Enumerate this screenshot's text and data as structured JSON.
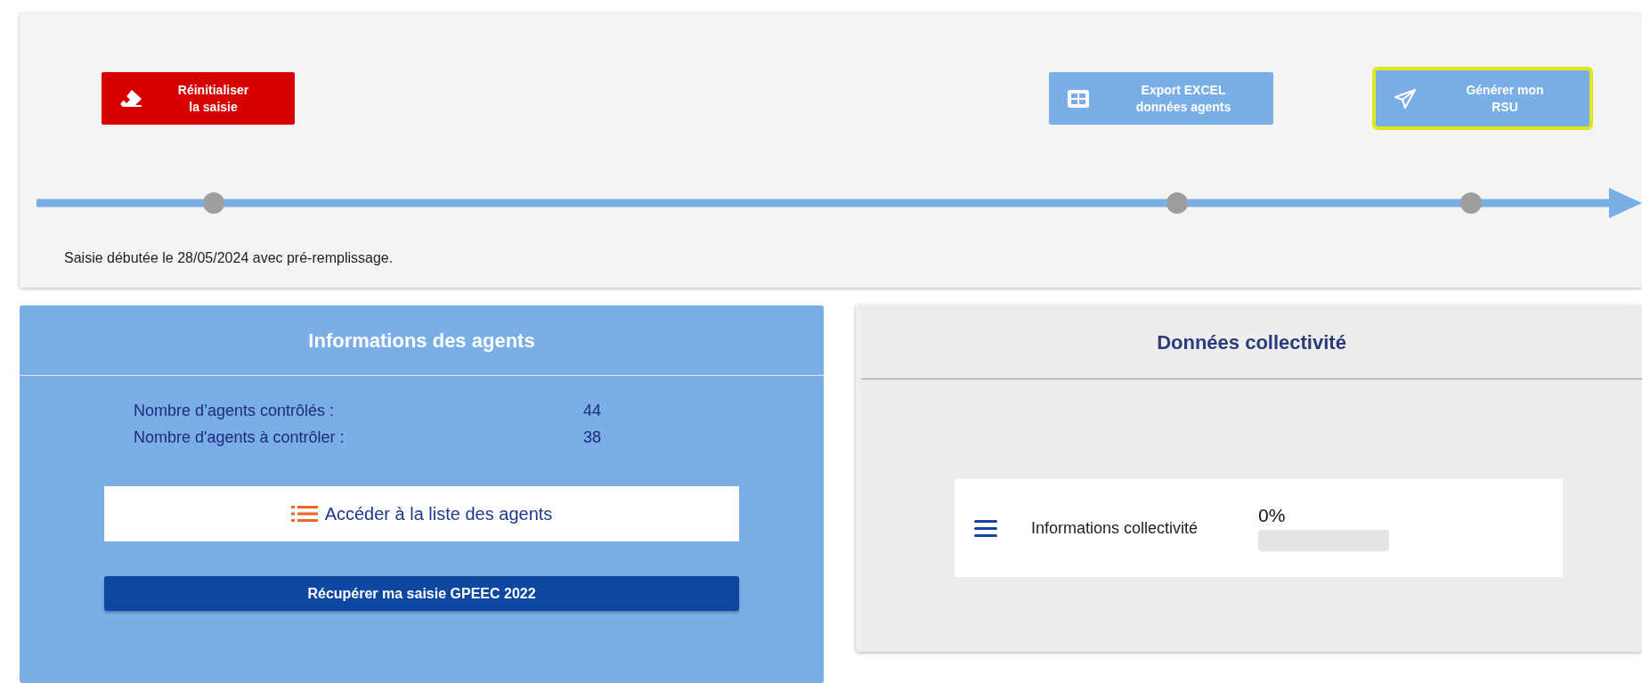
{
  "toolbar": {
    "buttons": [
      {
        "kind": "reset",
        "label": "Réinitialiser la saisie",
        "highlighted": false
      },
      {
        "kind": "export",
        "label": "Export EXCEL données agents",
        "highlighted": false
      },
      {
        "kind": "generate",
        "label": "Générer mon RSU",
        "highlighted": true
      }
    ]
  },
  "timeline": {
    "status": "Saisie débutée le 28/05/2024 avec pré-remplissage."
  },
  "agents_card": {
    "title": "Informations des agents",
    "stats": [
      {
        "label": "Nombre d’agents contrôlés :",
        "value": "44"
      },
      {
        "label": "Nombre d'agents à contrôler :",
        "value": "38"
      }
    ],
    "list_link": "Accéder à la liste des agents",
    "button": "Récupérer ma saisie GPEEC 2022"
  },
  "collectivite_card": {
    "title": "Données collectivité",
    "items": [
      {
        "label": "Informations collectivité",
        "percent": "0%",
        "level": 0
      }
    ]
  }
}
